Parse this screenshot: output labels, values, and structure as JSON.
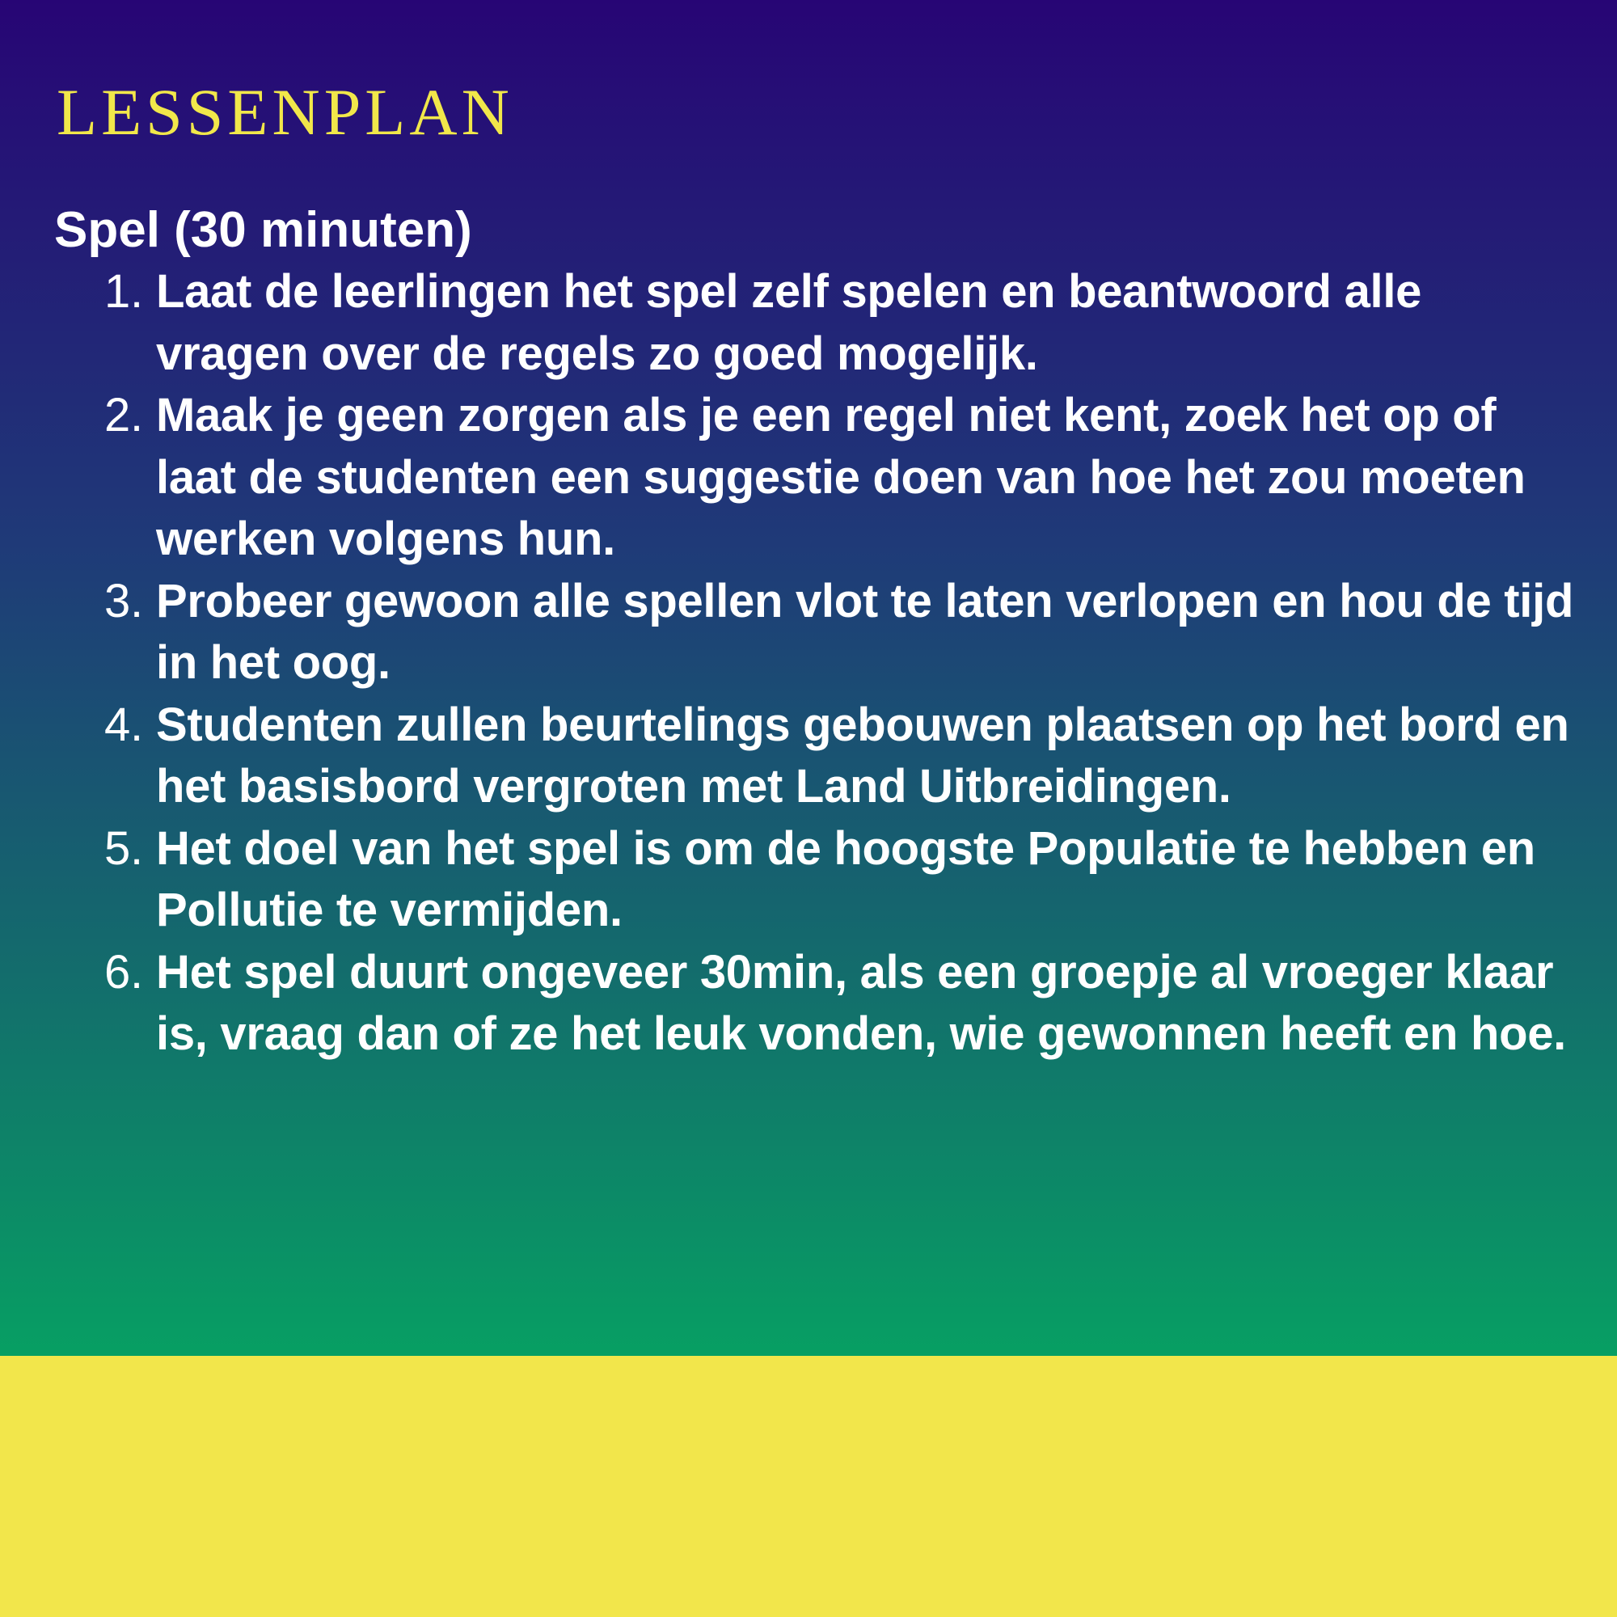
{
  "slide": {
    "title": "LESSENPLAN",
    "section_heading": "Spel (30 minuten)",
    "steps": [
      {
        "number": "1.",
        "text": "Laat de leerlingen het spel zelf spelen en beantwoord alle vragen over de regels zo goed mogelijk."
      },
      {
        "number": "2.",
        "text": "Maak je geen zorgen als je een regel niet kent, zoek het op of laat de studenten een suggestie doen van hoe het zou moeten werken volgens hun."
      },
      {
        "number": "3.",
        "text": "Probeer gewoon alle spellen vlot te laten verlopen en hou de tijd in het oog."
      },
      {
        "number": "4.",
        "text": "Studenten zullen beurtelings gebouwen plaatsen op het bord en het basisbord vergroten met Land Uitbreidingen."
      },
      {
        "number": "5.",
        "text": "Het doel van het spel is om de hoogste Populatie te hebben en Pollutie te vermijden."
      },
      {
        "number": "6.",
        "text": "Het spel duurt ongeveer 30min, als een groepje al vroeger klaar is, vraag dan of ze het leuk vonden, wie gewonnen heeft en hoe."
      }
    ]
  },
  "colors": {
    "title": "#f1e74a",
    "text": "#ffffff",
    "gradient_top": "#270575",
    "gradient_bottom": "#079f63",
    "footer_band": "#f2e64b"
  }
}
